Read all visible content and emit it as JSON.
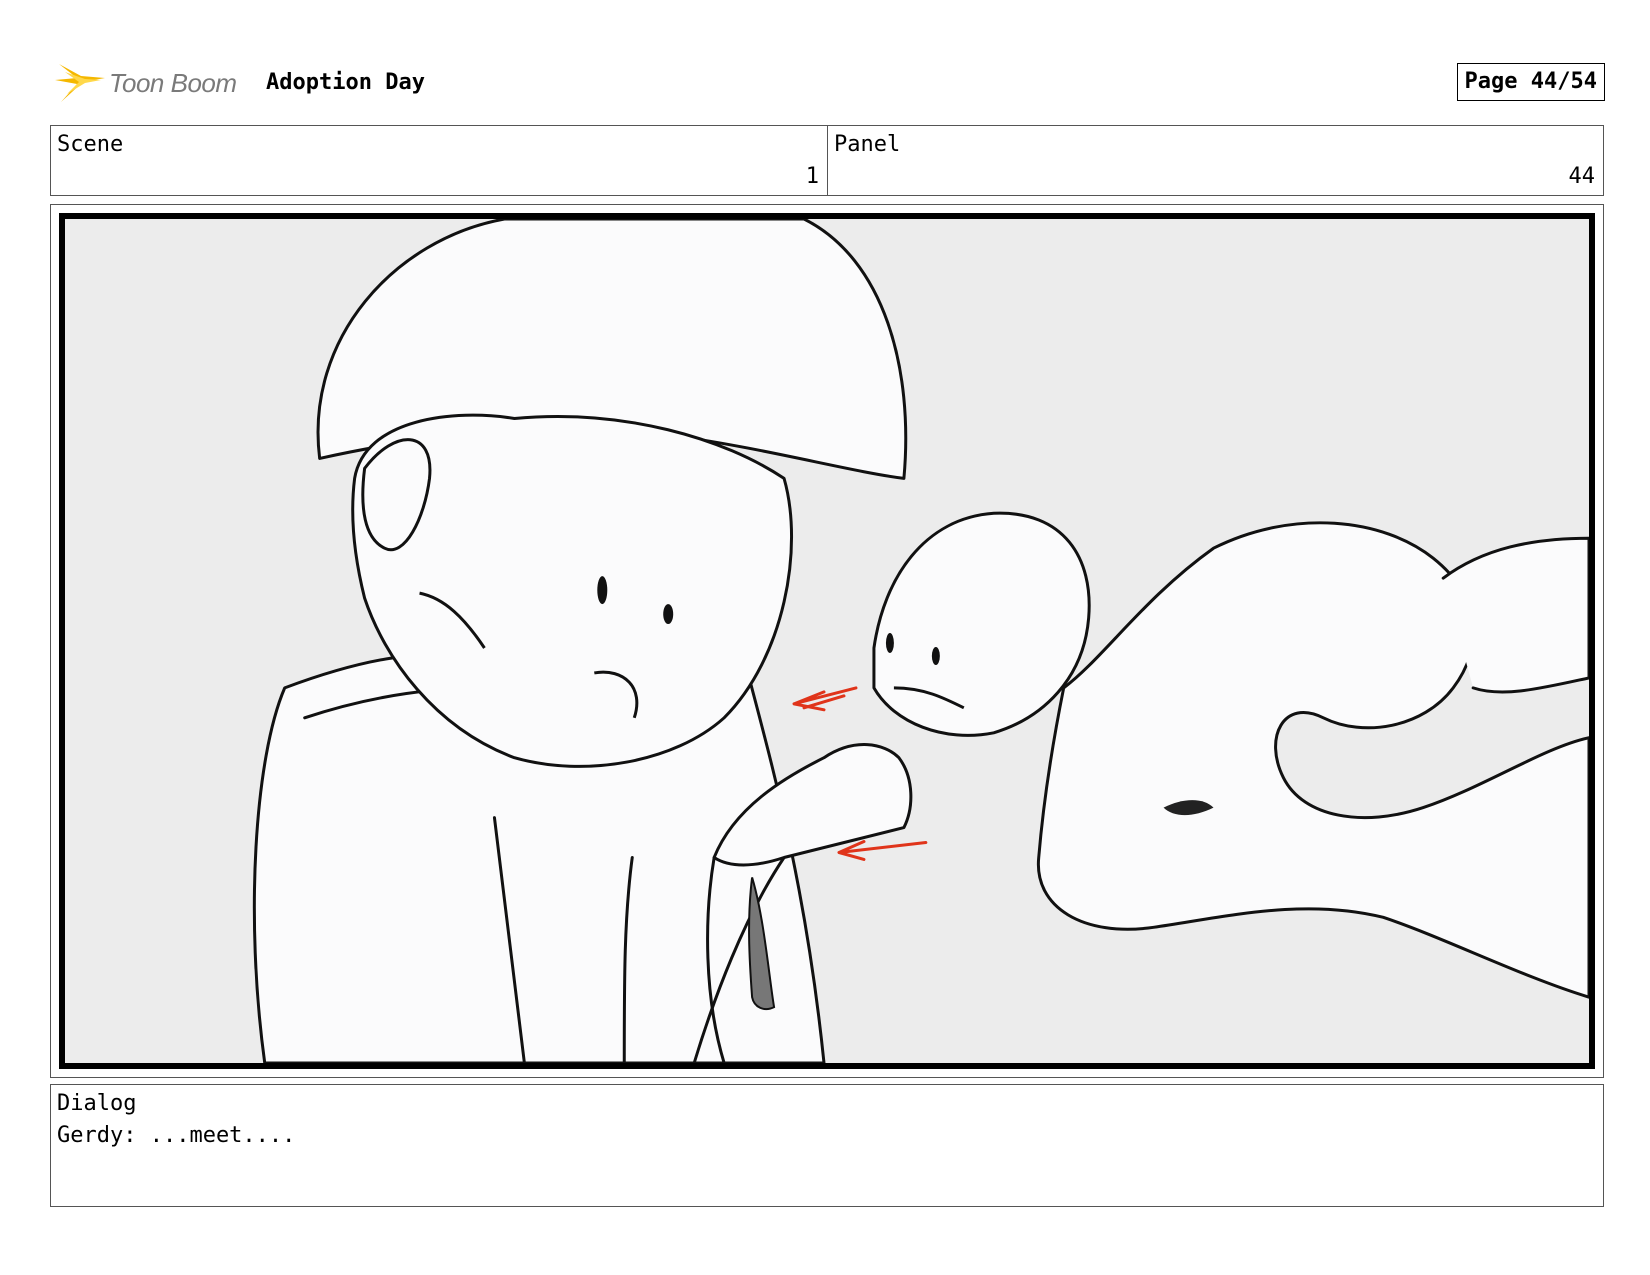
{
  "header": {
    "logo_text": "Toon Boom",
    "project_title": "Adoption Day",
    "page_label": "Page 44/54"
  },
  "info": {
    "scene_label": "Scene",
    "scene_value": "1",
    "panel_label": "Panel",
    "panel_value": "44"
  },
  "dialog": {
    "label": "Dialog",
    "text": "Gerdy: ...meet...."
  },
  "colors": {
    "logo_star": "#f5b800",
    "arrow": "#e0341a",
    "frame_bg": "#ececec"
  }
}
